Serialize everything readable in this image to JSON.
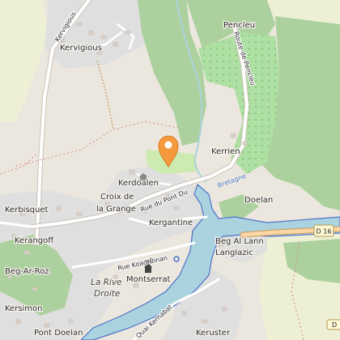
{
  "map": {
    "places": {
      "kervigious": "Kervigious",
      "pencleu": "Pencleu",
      "kerrien": "Kerrien",
      "kerdoalen": "Kerdoalen",
      "croix_de": "Croix de",
      "la_grange": "la Grange",
      "kerbisquet": "Kerbisquet",
      "kergantine": "Kergantine",
      "kerangoff": "Kerangoff",
      "beg_ar_roz": "Beg-Ar-Roz",
      "la_rive": "La Rive",
      "droite": "Droite",
      "montserrat": "Montserrat",
      "kersimon": "Kersimon",
      "pont_doelan": "Pont Doelan",
      "keruster": "Keruster",
      "doelan": "Doelan",
      "beg_al_lann": "Beg Al Lann",
      "langlazic": "Langlazic"
    },
    "roads": {
      "kervigious_road": "Kervigious",
      "route_de_pencleu": "Route de Pencleu",
      "rue_du_pont_du": "Rue du Pont Du",
      "rue_koad_binan": "Rue Koad Binan",
      "quai_kernabat": "Quai Kernabat",
      "d16_shield": "D 16",
      "d16_shield_2": "D"
    },
    "water_label": "Bretagne",
    "colors": {
      "land": "#ece7de",
      "residential": "#e0dfdf",
      "farmland": "#eef0d6",
      "forest": "#add19e",
      "orchard": "#aedfa3",
      "water": "#aad3df",
      "water_edge": "#4e72c9",
      "road": "#ffffff",
      "primary_road": "#fcd6a4",
      "marker": "#f59a3c"
    },
    "icons": {
      "marker": "map-pin-icon",
      "church": "church-icon"
    }
  }
}
